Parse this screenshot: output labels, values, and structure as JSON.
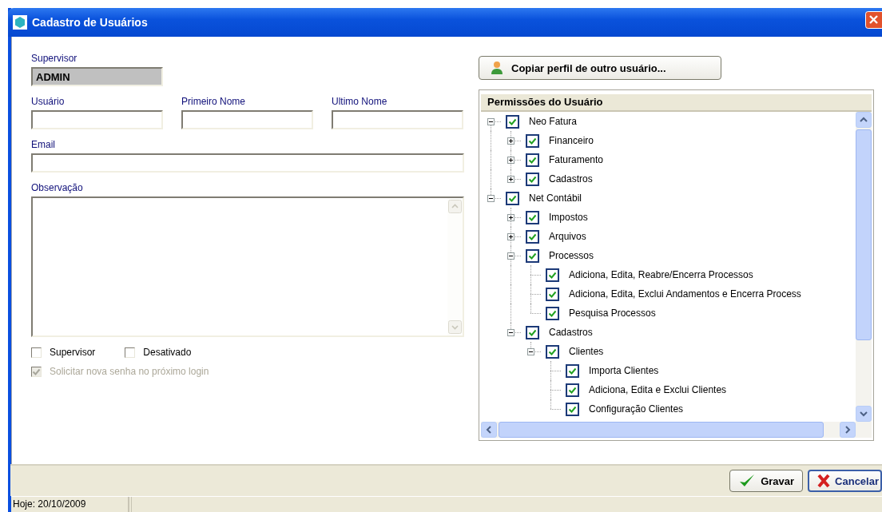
{
  "window": {
    "title": "Cadastro de Usuários"
  },
  "supervisor": {
    "label": "Supervisor",
    "value": "ADMIN"
  },
  "name_fields": [
    {
      "label": "Usuário"
    },
    {
      "label": "Primeiro Nome"
    },
    {
      "label": "Ultimo Nome"
    }
  ],
  "email": {
    "label": "Email"
  },
  "observation": {
    "label": "Observação"
  },
  "checkboxes": [
    {
      "label": "Supervisor",
      "checked": false,
      "disabled": false
    },
    {
      "label": "Desativado",
      "checked": false,
      "disabled": false
    },
    {
      "label": "Solicitar nova senha no próximo login",
      "checked": true,
      "disabled": true
    }
  ],
  "copy_button": {
    "label": "Copiar perfil de outro usuário..."
  },
  "permissions": {
    "title": "Permissões do Usuário",
    "tree": [
      {
        "label": "Neo Fatura",
        "checked": true,
        "expanded": true,
        "children": [
          {
            "label": "Financeiro",
            "checked": true,
            "expanded": false
          },
          {
            "label": "Faturamento",
            "checked": true,
            "expanded": false
          },
          {
            "label": "Cadastros",
            "checked": true,
            "expanded": false
          }
        ]
      },
      {
        "label": "Net Contábil",
        "checked": true,
        "expanded": true,
        "children": [
          {
            "label": "Impostos",
            "checked": true,
            "expanded": false
          },
          {
            "label": "Arquivos",
            "checked": true,
            "expanded": false
          },
          {
            "label": "Processos",
            "checked": true,
            "expanded": true,
            "children": [
              {
                "label": "Adiciona, Edita, Reabre/Encerra Processos",
                "checked": true
              },
              {
                "label": "Adiciona, Edita, Exclui Andamentos e Encerra Process",
                "checked": true
              },
              {
                "label": "Pesquisa Processos",
                "checked": true
              }
            ]
          },
          {
            "label": "Cadastros",
            "checked": true,
            "expanded": true,
            "children": [
              {
                "label": "Clientes",
                "checked": true,
                "expanded": true,
                "children": [
                  {
                    "label": "Importa Clientes",
                    "checked": true
                  },
                  {
                    "label": "Adiciona, Edita e Exclui Clientes",
                    "checked": true
                  },
                  {
                    "label": "Configuração Clientes",
                    "checked": true
                  }
                ]
              }
            ]
          }
        ]
      }
    ]
  },
  "buttons": [
    {
      "label": "Gravar",
      "kind": "save",
      "default": false
    },
    {
      "label": "Cancelar",
      "kind": "cancel",
      "default": true
    }
  ],
  "status_bar": [
    {
      "text": "Hoje: 20/10/2009"
    }
  ]
}
